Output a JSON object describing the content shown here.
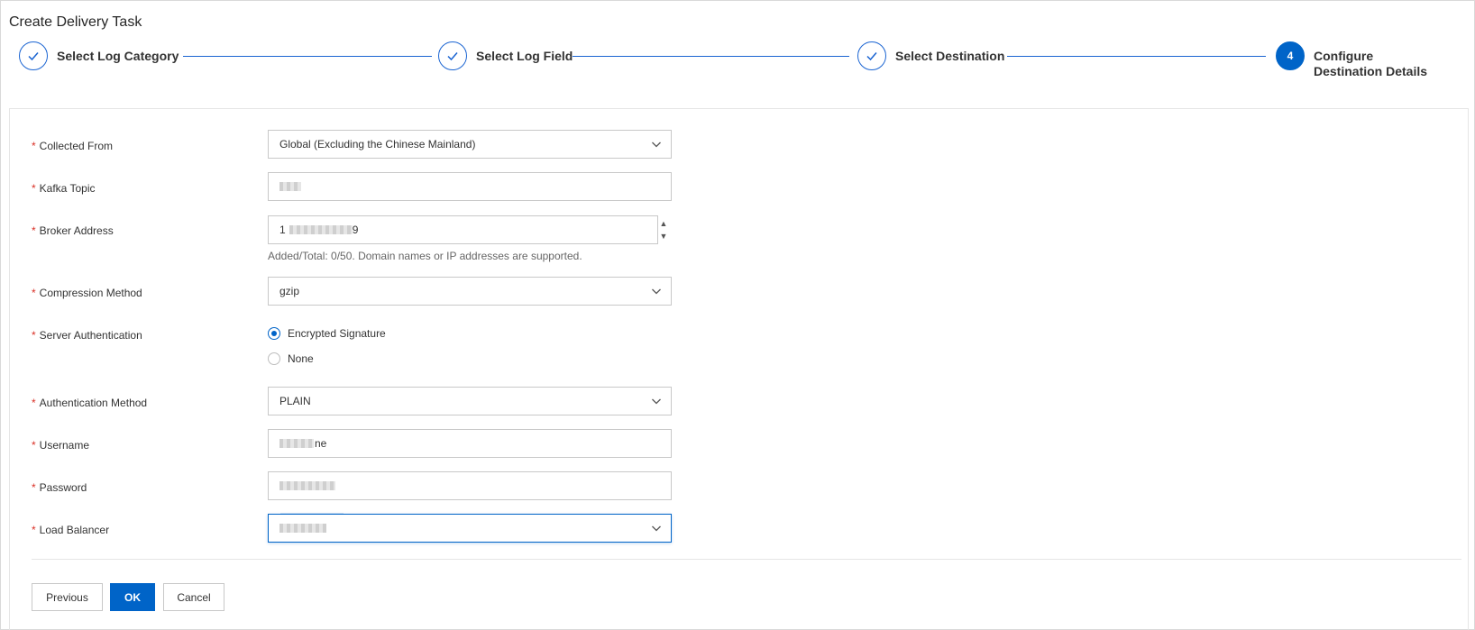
{
  "page": {
    "title": "Create Delivery Task"
  },
  "steps": [
    {
      "number": "1",
      "label": "Select Log Category",
      "status": "done",
      "icon": "check-icon"
    },
    {
      "number": "2",
      "label": "Select Log Field",
      "status": "done",
      "icon": "check-icon"
    },
    {
      "number": "3",
      "label": "Select Destination",
      "status": "done",
      "icon": "check-icon"
    },
    {
      "number": "4",
      "label_line1": "Configure",
      "label_line2": "Destination Details",
      "status": "active"
    }
  ],
  "form": {
    "collected_from": {
      "label": "Collected From",
      "value": "Global (Excluding the Chinese Mainland)"
    },
    "kafka_topic": {
      "label": "Kafka Topic",
      "value": ""
    },
    "broker_address": {
      "label": "Broker Address",
      "value_prefix": "1",
      "value_suffix": "9",
      "hint": "Added/Total: 0/50. Domain names or IP addresses are supported."
    },
    "compression_method": {
      "label": "Compression Method",
      "value": "gzip"
    },
    "server_authentication": {
      "label": "Server Authentication",
      "options": [
        "Encrypted Signature",
        "None"
      ],
      "selected": "Encrypted Signature"
    },
    "authentication_method": {
      "label": "Authentication Method",
      "value": "PLAIN"
    },
    "username": {
      "label": "Username",
      "value_suffix": "ne"
    },
    "password": {
      "label": "Password",
      "value": ""
    },
    "load_balancer": {
      "label": "Load Balancer",
      "value": ""
    },
    "required_mark": "*"
  },
  "buttons": {
    "previous": "Previous",
    "ok": "OK",
    "cancel": "Cancel"
  },
  "colors": {
    "primary": "#0064c8",
    "required": "#d93026",
    "border": "#c8c8c8"
  }
}
